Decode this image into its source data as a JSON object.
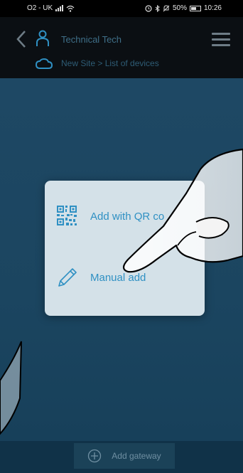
{
  "status_bar": {
    "carrier": "O2 - UK",
    "battery": "50%",
    "time": "10:26"
  },
  "header": {
    "title": "Technical Tech",
    "breadcrumb": "New Site > List of devices"
  },
  "popup": {
    "qr_label": "Add with QR co",
    "manual_label": "Manual add"
  },
  "footer": {
    "add_gateway_label": "Add gateway"
  },
  "colors": {
    "accent": "#2f90c3",
    "popup_bg": "#d4e1e8",
    "content_bg": "#1e4864"
  }
}
